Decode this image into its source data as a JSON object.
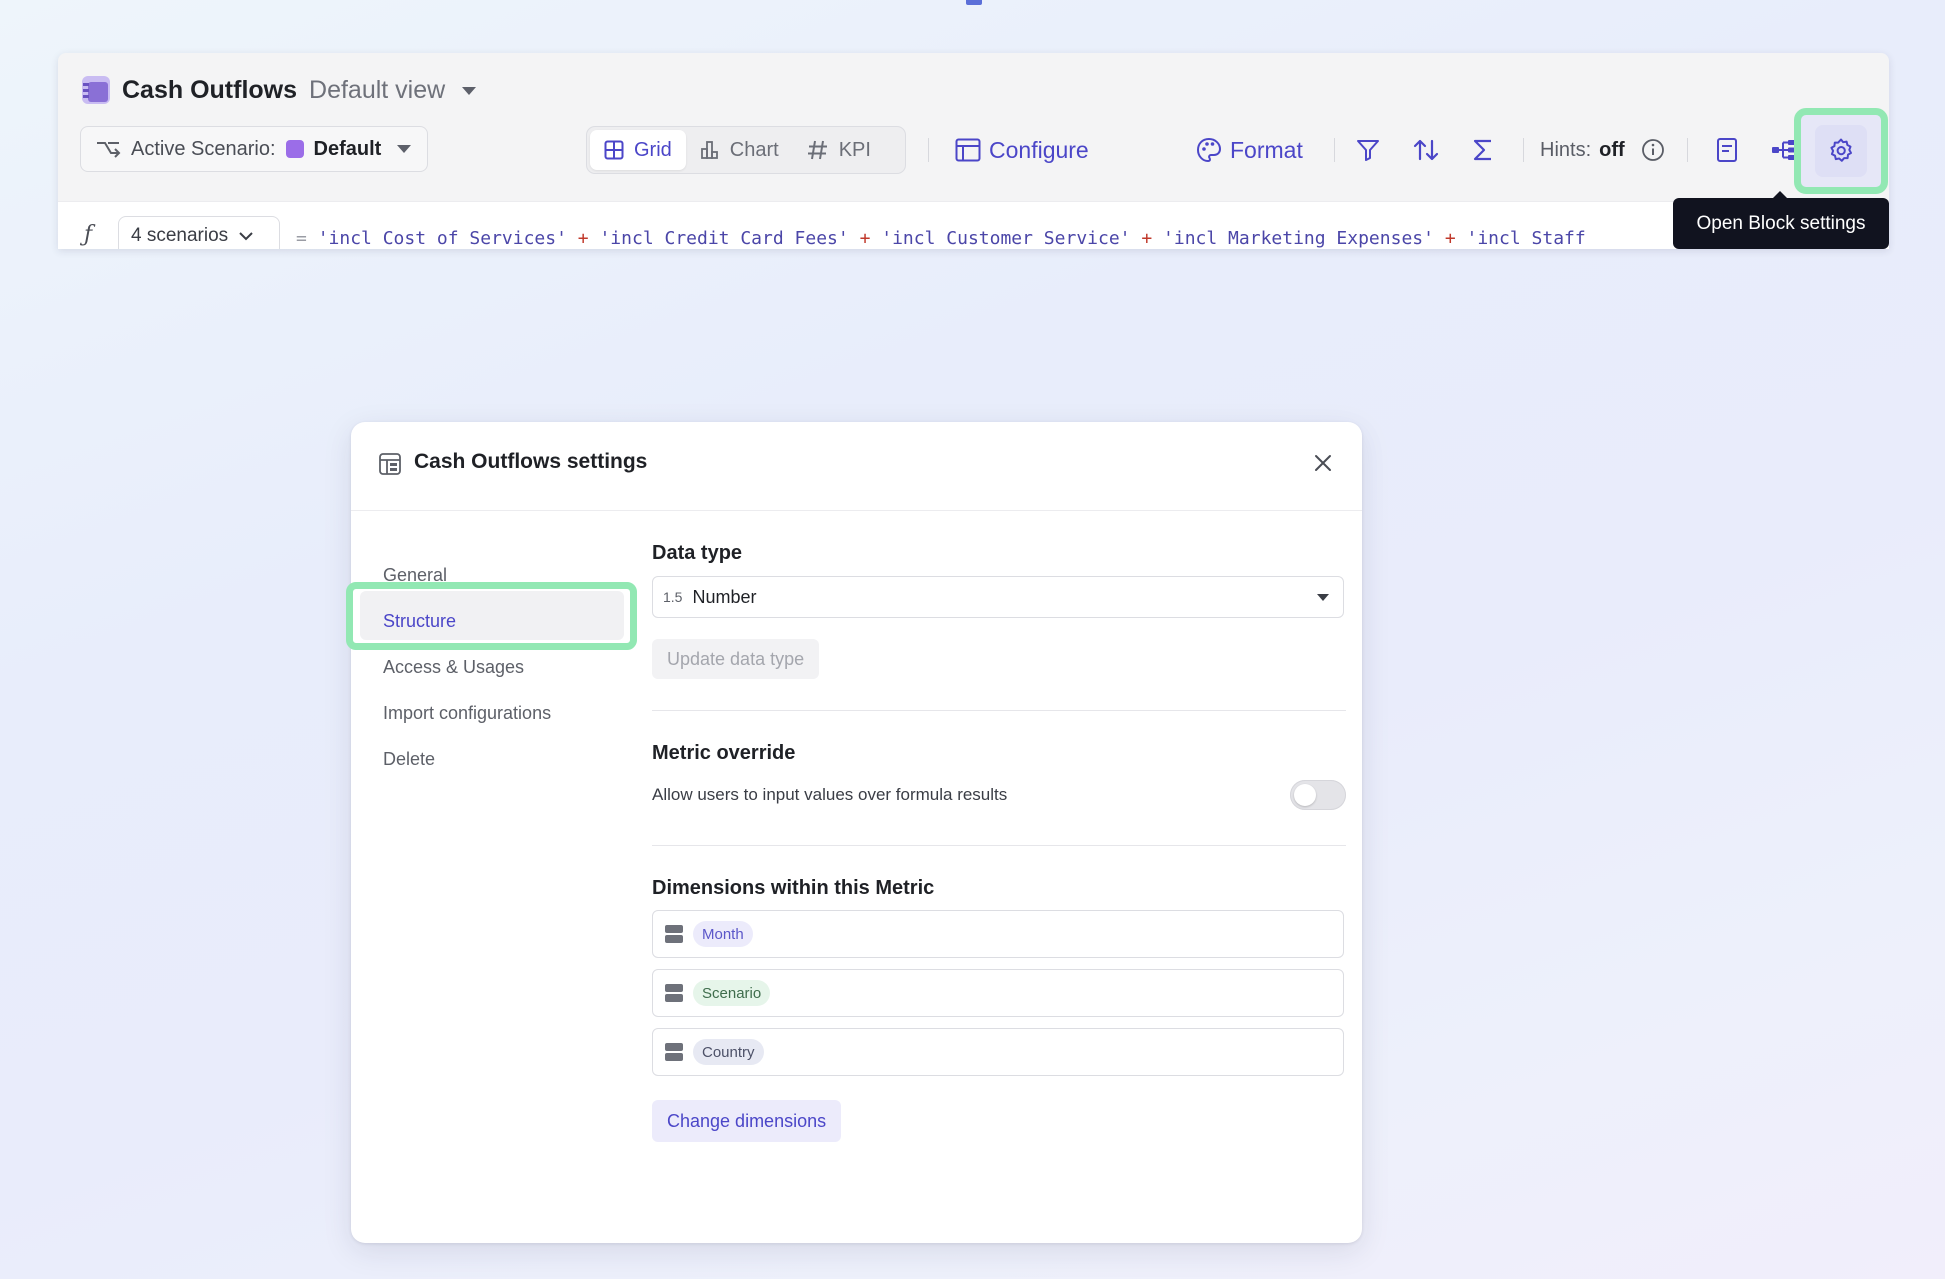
{
  "block": {
    "title": "Cash Outflows",
    "view": "Default view",
    "scenario_label": "Active Scenario:",
    "scenario_value": "Default",
    "scenario_color": "#9b6de8",
    "view_toggle": [
      {
        "label": "Grid",
        "icon": "grid-icon",
        "active": true
      },
      {
        "label": "Chart",
        "icon": "bar-chart-icon",
        "active": false
      },
      {
        "label": "KPI",
        "icon": "hash-icon",
        "active": false
      }
    ],
    "configure_label": "Configure",
    "format_label": "Format",
    "hints_label": "Hints:",
    "hints_value": "off",
    "accent_color": "#4b46c8",
    "formula": {
      "scenarios_label": "4 scenarios",
      "eq": "=",
      "terms": [
        "'incl Cost of Services'",
        "'incl Credit Card Fees'",
        "'incl Customer Service'",
        "'incl Marketing Expenses'",
        "'incl Staff"
      ],
      "operator": "+"
    },
    "tooltip": "Open Block settings",
    "highlight_color": "#92e8b3"
  },
  "modal": {
    "title": "Cash Outflows settings",
    "nav": [
      {
        "label": "General",
        "active": false
      },
      {
        "label": "Structure",
        "active": true
      },
      {
        "label": "Access & Usages",
        "active": false
      },
      {
        "label": "Import configurations",
        "active": false
      },
      {
        "label": "Delete",
        "active": false
      }
    ],
    "data_type": {
      "title": "Data type",
      "prefix": "1.5",
      "value": "Number",
      "update_button": "Update data type"
    },
    "metric_override": {
      "title": "Metric override",
      "description": "Allow users to input values over formula results",
      "enabled": false
    },
    "dimensions": {
      "title": "Dimensions within this Metric",
      "items": [
        {
          "label": "Month",
          "bg": "#ecebfb",
          "fg": "#5b57c9"
        },
        {
          "label": "Scenario",
          "bg": "#e6f5ea",
          "fg": "#3f6d4c"
        },
        {
          "label": "Country",
          "bg": "#e7e9f3",
          "fg": "#4d5168"
        }
      ],
      "change_button": "Change dimensions"
    }
  }
}
